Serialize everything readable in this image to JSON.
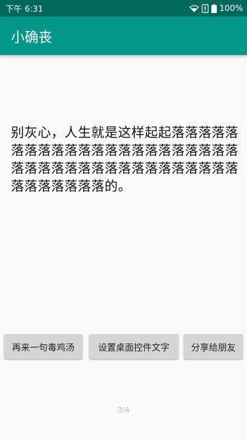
{
  "status_bar": {
    "time": "下午 6:31",
    "battery": "100%",
    "icons": [
      "wifi-icon",
      "alert-icon",
      "battery-icon"
    ]
  },
  "app_bar": {
    "title": "小确丧"
  },
  "main": {
    "quote": "别灰心，人生就是这样起起落落落落落落落落落落落落落落落落落落落落落落落落落落落落落落落落落落落落落落落落落落落落落落的。"
  },
  "buttons": {
    "new_quote": "再来一句毒鸡汤",
    "set_widget": "设置桌面控件文字",
    "share": "分享给朋友"
  },
  "page_indicator": "3/4",
  "colors": {
    "status_bar": "#00695c",
    "app_bar": "#009688",
    "background": "#fafafa",
    "button": "#d6d6d6"
  }
}
